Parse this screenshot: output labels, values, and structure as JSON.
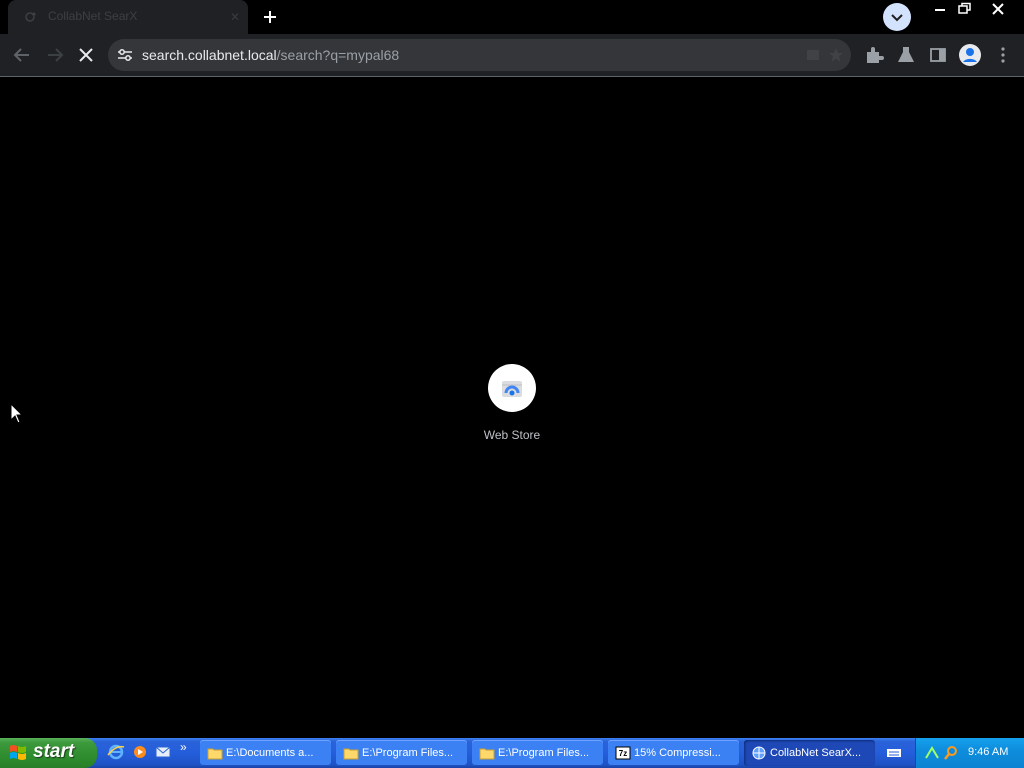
{
  "browser": {
    "tab": {
      "title": "CollabNet SearX"
    },
    "url": {
      "host": "search.collabnet.local",
      "path": "/search?q=mypal68"
    }
  },
  "content": {
    "tile": {
      "label": "Web Store"
    }
  },
  "taskbar": {
    "start_label": "start",
    "tasks": [
      {
        "label": "E:\\Documents a..."
      },
      {
        "label": "E:\\Program Files..."
      },
      {
        "label": "E:\\Program Files..."
      },
      {
        "label": "15% Compressi..."
      },
      {
        "label": "CollabNet SearX..."
      }
    ],
    "quicklaunch_more": "»",
    "clock": "9:46 AM"
  },
  "colors": {
    "accent": "#8ab4f8",
    "taskbar_blue": "#245edb",
    "start_green": "#2f8d2f",
    "tray_blue": "#0e8ddc"
  }
}
